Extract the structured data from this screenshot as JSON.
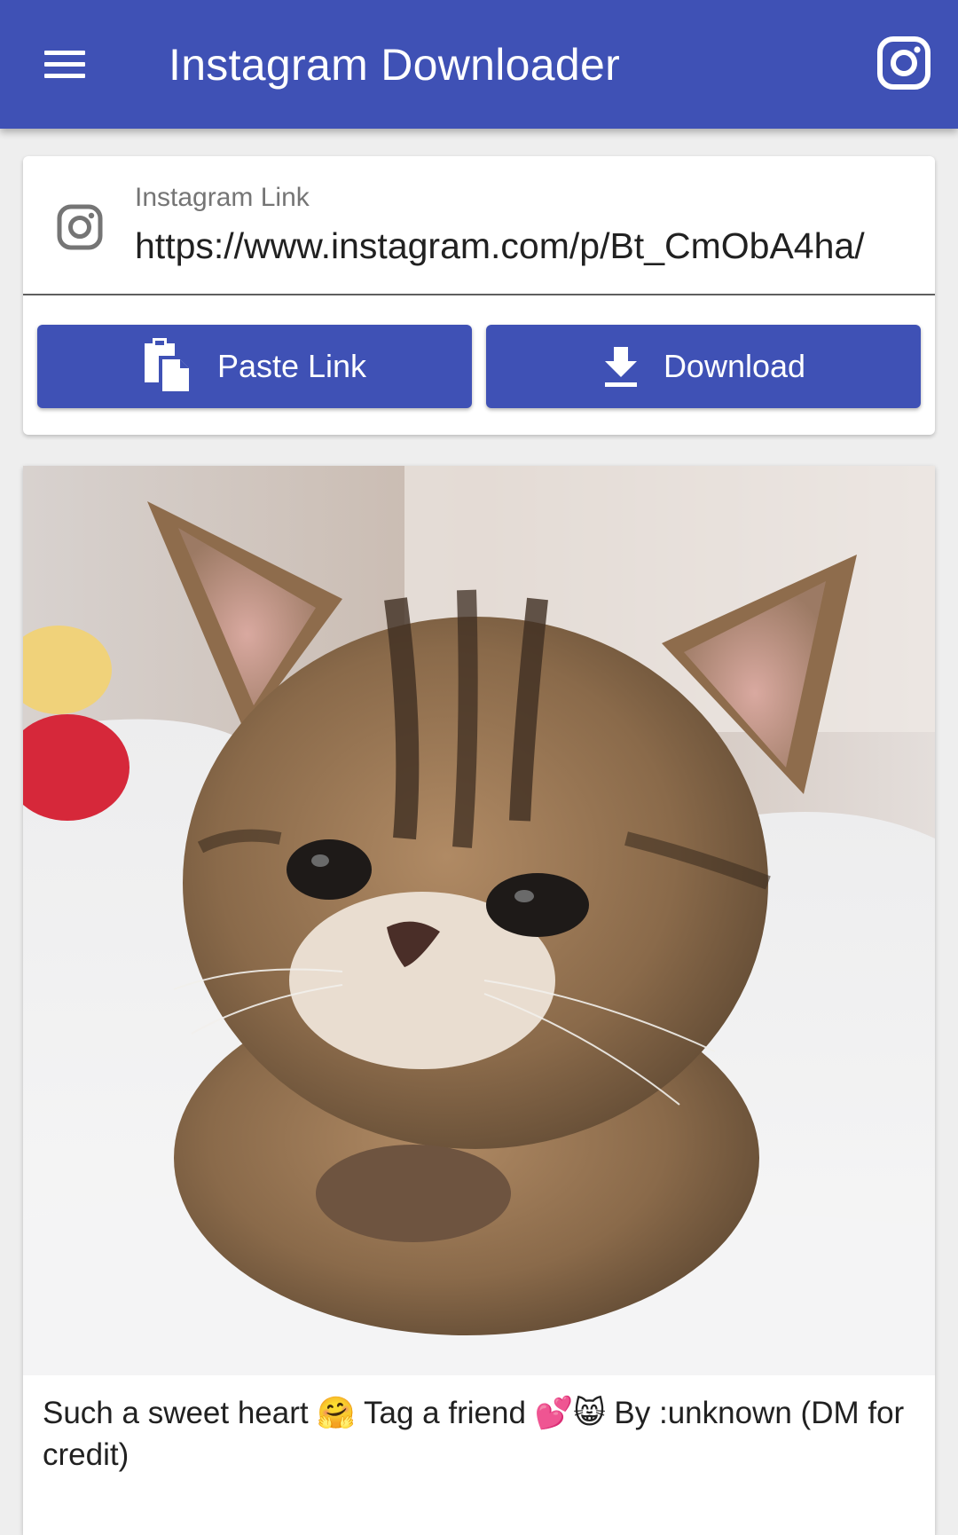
{
  "appbar": {
    "title": "Instagram Downloader",
    "menu_icon": "hamburger-menu-icon",
    "action_icon": "instagram-icon",
    "color": "#3f51b5"
  },
  "link_form": {
    "label": "Instagram Link",
    "value": "https://www.instagram.com/p/Bt_CmObA4ha/",
    "leading_icon": "instagram-icon"
  },
  "buttons": {
    "paste_label": "Paste Link",
    "paste_icon": "clipboard-paste-icon",
    "download_label": "Download",
    "download_icon": "download-icon"
  },
  "post": {
    "image": "tabby-kitten-photo",
    "caption": "Such a sweet heart 🤗 Tag a friend 💕😸 By :unknown (DM for credit)"
  }
}
